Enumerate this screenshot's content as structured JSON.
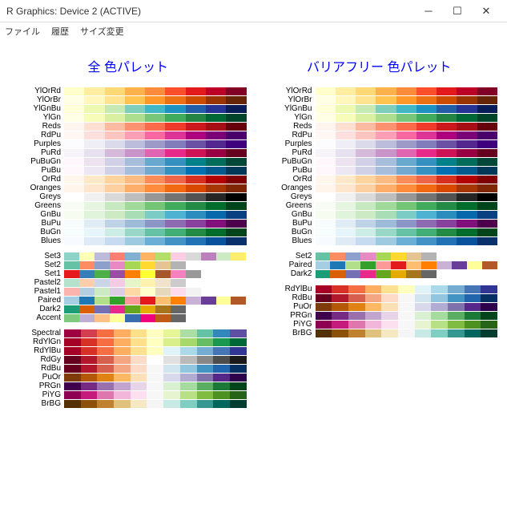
{
  "window": {
    "title": "R Graphics: Device 2 (ACTIVE)"
  },
  "menu": [
    "ファイル",
    "履歴",
    "サイズ変更"
  ],
  "chart_data": {
    "type": "table",
    "left_title": "全 色パレット",
    "right_title": "バリアフリー 色パレット",
    "sequential": [
      {
        "name": "YlOrRd",
        "colors": [
          "#ffffcc",
          "#ffeda0",
          "#fed976",
          "#feb24c",
          "#fd8d3c",
          "#fc4e2a",
          "#e31a1c",
          "#bd0026",
          "#800026"
        ]
      },
      {
        "name": "YlOrBr",
        "colors": [
          "#ffffe5",
          "#fff7bc",
          "#fee391",
          "#fec44f",
          "#fe9929",
          "#ec7014",
          "#cc4c02",
          "#993404",
          "#662506"
        ]
      },
      {
        "name": "YlGnBu",
        "colors": [
          "#ffffd9",
          "#edf8b1",
          "#c7e9b4",
          "#7fcdbb",
          "#41b6c4",
          "#1d91c0",
          "#225ea8",
          "#253494",
          "#081d58"
        ]
      },
      {
        "name": "YlGn",
        "colors": [
          "#ffffe5",
          "#f7fcb9",
          "#d9f0a3",
          "#addd8e",
          "#78c679",
          "#41ab5d",
          "#238443",
          "#006837",
          "#004529"
        ]
      },
      {
        "name": "Reds",
        "colors": [
          "#fff5f0",
          "#fee0d2",
          "#fcbba1",
          "#fc9272",
          "#fb6a4a",
          "#ef3b2c",
          "#cb181d",
          "#a50f15",
          "#67000d"
        ]
      },
      {
        "name": "RdPu",
        "colors": [
          "#fff7f3",
          "#fde0dd",
          "#fcc5c0",
          "#fa9fb5",
          "#f768a1",
          "#dd3497",
          "#ae017e",
          "#7a0177",
          "#49006a"
        ]
      },
      {
        "name": "Purples",
        "colors": [
          "#fcfbfd",
          "#efedf5",
          "#dadaeb",
          "#bcbddc",
          "#9e9ac8",
          "#807dba",
          "#6a51a3",
          "#54278f",
          "#3f007d"
        ]
      },
      {
        "name": "PuRd",
        "colors": [
          "#f7f4f9",
          "#e7e1ef",
          "#d4b9da",
          "#c994c7",
          "#df65b0",
          "#e7298a",
          "#ce1256",
          "#980043",
          "#67001f"
        ]
      },
      {
        "name": "PuBuGn",
        "colors": [
          "#fff7fb",
          "#ece2f0",
          "#d0d1e6",
          "#a6bddb",
          "#67a9cf",
          "#3690c0",
          "#02818a",
          "#016c59",
          "#014636"
        ]
      },
      {
        "name": "PuBu",
        "colors": [
          "#fff7fb",
          "#ece7f2",
          "#d0d1e6",
          "#a6bddb",
          "#74a9cf",
          "#3690c0",
          "#0570b0",
          "#045a8d",
          "#023858"
        ]
      },
      {
        "name": "OrRd",
        "colors": [
          "#fff7ec",
          "#fee8c8",
          "#fdd49e",
          "#fdbb84",
          "#fc8d59",
          "#ef6548",
          "#d7301f",
          "#b30000",
          "#7f0000"
        ]
      },
      {
        "name": "Oranges",
        "colors": [
          "#fff5eb",
          "#fee6ce",
          "#fdd0a2",
          "#fdae6b",
          "#fd8d3c",
          "#f16913",
          "#d94801",
          "#a63603",
          "#7f2704"
        ]
      },
      {
        "name": "Greys",
        "colors": [
          "#ffffff",
          "#f0f0f0",
          "#d9d9d9",
          "#bdbdbd",
          "#969696",
          "#737373",
          "#525252",
          "#252525",
          "#000000"
        ]
      },
      {
        "name": "Greens",
        "colors": [
          "#f7fcf5",
          "#e5f5e0",
          "#c7e9c0",
          "#a1d99b",
          "#74c476",
          "#41ab5d",
          "#238b45",
          "#006d2c",
          "#00441b"
        ]
      },
      {
        "name": "GnBu",
        "colors": [
          "#f7fcf0",
          "#e0f3db",
          "#ccebc5",
          "#a8ddb5",
          "#7bccc4",
          "#4eb3d3",
          "#2b8cbe",
          "#0868ac",
          "#084081"
        ]
      },
      {
        "name": "BuPu",
        "colors": [
          "#f7fcfd",
          "#e0ecf4",
          "#bfd3e6",
          "#9ebcda",
          "#8c96c6",
          "#8c6bb1",
          "#88419d",
          "#810f7c",
          "#4d004b"
        ]
      },
      {
        "name": "BuGn",
        "colors": [
          "#f7fcfd",
          "#e5f5f9",
          "#ccece6",
          "#99d8c9",
          "#66c2a4",
          "#41ae76",
          "#238b45",
          "#006d2c",
          "#00441b"
        ]
      },
      {
        "name": "Blues",
        "colors": [
          "#f7fbff",
          "#deebf7",
          "#c6dbef",
          "#9ecae1",
          "#6baed6",
          "#4292c6",
          "#2171b5",
          "#08519c",
          "#08306b"
        ]
      }
    ],
    "qualitative_all": [
      {
        "name": "Set3",
        "colors": [
          "#8dd3c7",
          "#ffffb3",
          "#bebada",
          "#fb8072",
          "#80b1d3",
          "#fdb462",
          "#b3de69",
          "#fccde5",
          "#d9d9d9",
          "#bc80bd",
          "#ccebc5",
          "#ffed6f"
        ]
      },
      {
        "name": "Set2",
        "colors": [
          "#66c2a5",
          "#fc8d62",
          "#8da0cb",
          "#e78ac3",
          "#a6d854",
          "#ffd92f",
          "#e5c494",
          "#b3b3b3"
        ]
      },
      {
        "name": "Set1",
        "colors": [
          "#e41a1c",
          "#377eb8",
          "#4daf4a",
          "#984ea3",
          "#ff7f00",
          "#ffff33",
          "#a65628",
          "#f781bf",
          "#999999"
        ]
      },
      {
        "name": "Pastel2",
        "colors": [
          "#b3e2cd",
          "#fdcdac",
          "#cbd5e8",
          "#f4cae4",
          "#e6f5c9",
          "#fff2ae",
          "#f1e2cc",
          "#cccccc"
        ]
      },
      {
        "name": "Pastel1",
        "colors": [
          "#fbb4ae",
          "#b3cde3",
          "#ccebc5",
          "#decbe4",
          "#fed9a6",
          "#ffffcc",
          "#e5d8bd",
          "#fddaec",
          "#f2f2f2"
        ]
      },
      {
        "name": "Paired",
        "colors": [
          "#a6cee3",
          "#1f78b4",
          "#b2df8a",
          "#33a02c",
          "#fb9a99",
          "#e31a1c",
          "#fdbf6f",
          "#ff7f00",
          "#cab2d6",
          "#6a3d9a",
          "#ffff99",
          "#b15928"
        ]
      },
      {
        "name": "Dark2",
        "colors": [
          "#1b9e77",
          "#d95f02",
          "#7570b3",
          "#e7298a",
          "#66a61e",
          "#e6ab02",
          "#a6761d",
          "#666666"
        ]
      },
      {
        "name": "Accent",
        "colors": [
          "#7fc97f",
          "#beaed4",
          "#fdc086",
          "#ffff99",
          "#386cb0",
          "#f0027f",
          "#bf5b17",
          "#666666"
        ]
      }
    ],
    "qualitative_cb": [
      {
        "name": "Set2",
        "colors": [
          "#66c2a5",
          "#fc8d62",
          "#8da0cb",
          "#e78ac3",
          "#a6d854",
          "#ffd92f",
          "#e5c494",
          "#b3b3b3"
        ]
      },
      {
        "name": "Paired",
        "colors": [
          "#a6cee3",
          "#1f78b4",
          "#b2df8a",
          "#33a02c",
          "#fb9a99",
          "#e31a1c",
          "#fdbf6f",
          "#ff7f00",
          "#cab2d6",
          "#6a3d9a",
          "#ffff99",
          "#b15928"
        ]
      },
      {
        "name": "Dark2",
        "colors": [
          "#1b9e77",
          "#d95f02",
          "#7570b3",
          "#e7298a",
          "#66a61e",
          "#e6ab02",
          "#a6761d",
          "#666666"
        ]
      }
    ],
    "diverging_all": [
      {
        "name": "Spectral",
        "colors": [
          "#9e0142",
          "#d53e4f",
          "#f46d43",
          "#fdae61",
          "#fee08b",
          "#ffffbf",
          "#e6f598",
          "#abdda4",
          "#66c2a5",
          "#3288bd",
          "#5e4fa2"
        ]
      },
      {
        "name": "RdYlGn",
        "colors": [
          "#a50026",
          "#d73027",
          "#f46d43",
          "#fdae61",
          "#fee08b",
          "#ffffbf",
          "#d9ef8b",
          "#a6d96a",
          "#66bd63",
          "#1a9850",
          "#006837"
        ]
      },
      {
        "name": "RdYlBu",
        "colors": [
          "#a50026",
          "#d73027",
          "#f46d43",
          "#fdae61",
          "#fee090",
          "#ffffbf",
          "#e0f3f8",
          "#abd9e9",
          "#74add1",
          "#4575b4",
          "#313695"
        ]
      },
      {
        "name": "RdGy",
        "colors": [
          "#67001f",
          "#b2182b",
          "#d6604d",
          "#f4a582",
          "#fddbc7",
          "#ffffff",
          "#e0e0e0",
          "#bababa",
          "#878787",
          "#4d4d4d",
          "#1a1a1a"
        ]
      },
      {
        "name": "RdBu",
        "colors": [
          "#67001f",
          "#b2182b",
          "#d6604d",
          "#f4a582",
          "#fddbc7",
          "#f7f7f7",
          "#d1e5f0",
          "#92c5de",
          "#4393c3",
          "#2166ac",
          "#053061"
        ]
      },
      {
        "name": "PuOr",
        "colors": [
          "#7f3b08",
          "#b35806",
          "#e08214",
          "#fdb863",
          "#fee0b6",
          "#f7f7f7",
          "#d8daeb",
          "#b2abd2",
          "#8073ac",
          "#542788",
          "#2d004b"
        ]
      },
      {
        "name": "PRGn",
        "colors": [
          "#40004b",
          "#762a83",
          "#9970ab",
          "#c2a5cf",
          "#e7d4e8",
          "#f7f7f7",
          "#d9f0d3",
          "#a6dba0",
          "#5aae61",
          "#1b7837",
          "#00441b"
        ]
      },
      {
        "name": "PiYG",
        "colors": [
          "#8e0152",
          "#c51b7d",
          "#de77ae",
          "#f1b6da",
          "#fde0ef",
          "#f7f7f7",
          "#e6f5d0",
          "#b8e186",
          "#7fbc41",
          "#4d9221",
          "#276419"
        ]
      },
      {
        "name": "BrBG",
        "colors": [
          "#543005",
          "#8c510a",
          "#bf812d",
          "#dfc27d",
          "#f6e8c3",
          "#f5f5f5",
          "#c7eae5",
          "#80cdc1",
          "#35978f",
          "#01665e",
          "#003c30"
        ]
      }
    ],
    "diverging_cb": [
      {
        "name": "RdYlBu",
        "colors": [
          "#a50026",
          "#d73027",
          "#f46d43",
          "#fdae61",
          "#fee090",
          "#ffffbf",
          "#e0f3f8",
          "#abd9e9",
          "#74add1",
          "#4575b4",
          "#313695"
        ]
      },
      {
        "name": "RdBu",
        "colors": [
          "#67001f",
          "#b2182b",
          "#d6604d",
          "#f4a582",
          "#fddbc7",
          "#f7f7f7",
          "#d1e5f0",
          "#92c5de",
          "#4393c3",
          "#2166ac",
          "#053061"
        ]
      },
      {
        "name": "PuOr",
        "colors": [
          "#7f3b08",
          "#b35806",
          "#e08214",
          "#fdb863",
          "#fee0b6",
          "#f7f7f7",
          "#d8daeb",
          "#b2abd2",
          "#8073ac",
          "#542788",
          "#2d004b"
        ]
      },
      {
        "name": "PRGn",
        "colors": [
          "#40004b",
          "#762a83",
          "#9970ab",
          "#c2a5cf",
          "#e7d4e8",
          "#f7f7f7",
          "#d9f0d3",
          "#a6dba0",
          "#5aae61",
          "#1b7837",
          "#00441b"
        ]
      },
      {
        "name": "PiYG",
        "colors": [
          "#8e0152",
          "#c51b7d",
          "#de77ae",
          "#f1b6da",
          "#fde0ef",
          "#f7f7f7",
          "#e6f5d0",
          "#b8e186",
          "#7fbc41",
          "#4d9221",
          "#276419"
        ]
      },
      {
        "name": "BrBG",
        "colors": [
          "#543005",
          "#8c510a",
          "#bf812d",
          "#dfc27d",
          "#f6e8c3",
          "#f5f5f5",
          "#c7eae5",
          "#80cdc1",
          "#35978f",
          "#01665e",
          "#003c30"
        ]
      }
    ]
  }
}
